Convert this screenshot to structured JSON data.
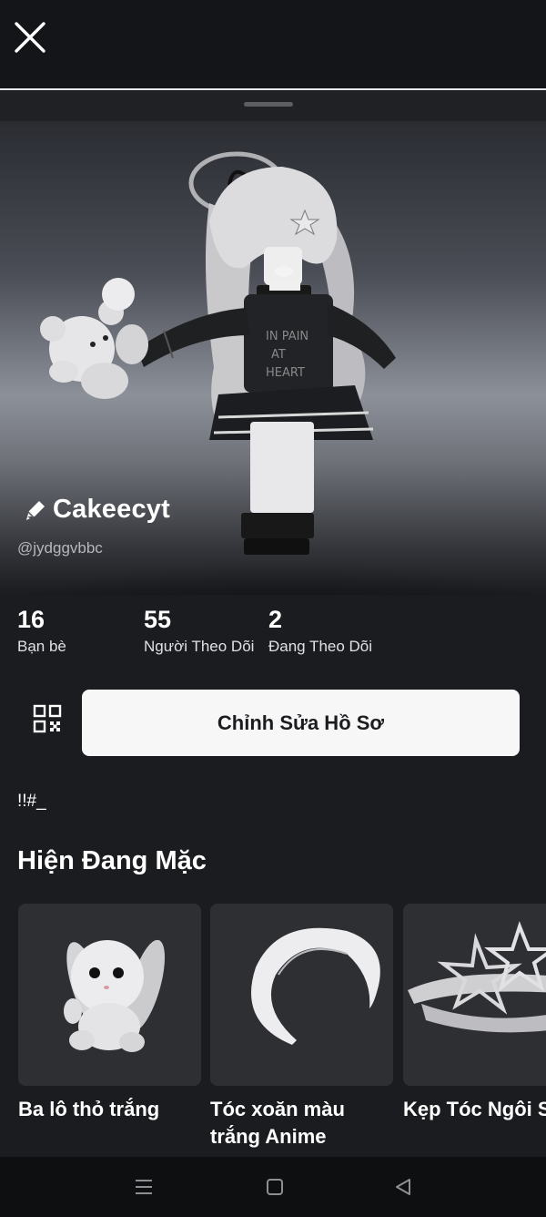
{
  "header": {
    "close_icon": "close-icon"
  },
  "profile": {
    "display_name": "Cakeecyt",
    "username": "@jydggvbbc",
    "edit_icon": "pencil-icon"
  },
  "stats": [
    {
      "value": "16",
      "label": "Bạn bè"
    },
    {
      "value": "55",
      "label": "Người Theo Dõi"
    },
    {
      "value": "2",
      "label": "Đang Theo Dõi"
    }
  ],
  "actions": {
    "qr_icon": "qr-code-icon",
    "edit_profile_label": "Chỉnh Sửa Hồ Sơ"
  },
  "bio": "!!#_",
  "wearing": {
    "title": "Hiện Đang Mặc",
    "items": [
      {
        "name": "Ba lô thỏ trắng"
      },
      {
        "name": "Tóc xoăn màu trắng Anime"
      },
      {
        "name": "Kẹp Tóc Ngôi Sao Bạc"
      }
    ]
  },
  "system_nav": {
    "icons": [
      "menu-icon",
      "home-square-icon",
      "back-triangle-icon"
    ]
  },
  "colors": {
    "background": "#1b1c1f",
    "button_bg": "#f7f7f8",
    "card_bg": "#2e2f33",
    "muted_text": "#b5b7bd"
  }
}
